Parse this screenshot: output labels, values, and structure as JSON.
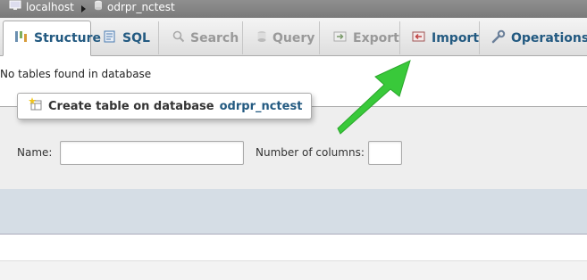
{
  "breadcrumb": {
    "server": "localhost",
    "database": "odrpr_nctest"
  },
  "tabs": [
    {
      "label": "Structure",
      "icon": "structure-icon",
      "state": "active"
    },
    {
      "label": "SQL",
      "icon": "sql-icon",
      "state": "enabled"
    },
    {
      "label": "Search",
      "icon": "search-icon",
      "state": "disabled"
    },
    {
      "label": "Query",
      "icon": "query-icon",
      "state": "disabled"
    },
    {
      "label": "Export",
      "icon": "export-icon",
      "state": "disabled"
    },
    {
      "label": "Import",
      "icon": "import-icon",
      "state": "enabled"
    },
    {
      "label": "Operations",
      "icon": "wrench-icon",
      "state": "enabled"
    }
  ],
  "main": {
    "notice": "No tables found in database",
    "create_table": {
      "legend_prefix": "Create table on database",
      "database": "odrpr_nctest",
      "name_label": "Name:",
      "name_value": "",
      "columns_label": "Number of columns:",
      "columns_value": ""
    }
  },
  "annotation": {
    "type": "green-arrow",
    "points_to": "Import",
    "color": "#33cc33"
  },
  "colors": {
    "accent": "#235a81",
    "topbar": "#858585",
    "fieldset": "#eeeeee"
  }
}
